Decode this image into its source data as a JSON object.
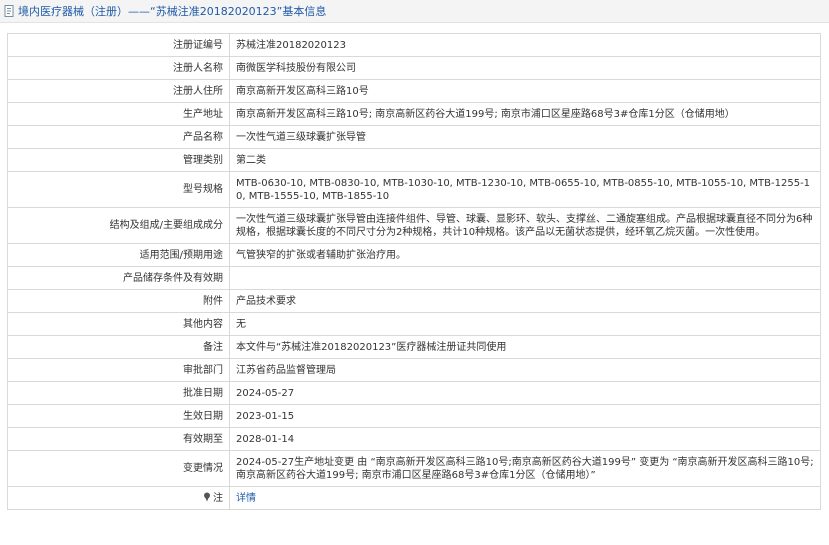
{
  "header": {
    "title": "境内医疗器械（注册）——“苏械注准20182020123”基本信息"
  },
  "rows": [
    {
      "label": "注册证编号",
      "value": "苏械注准20182020123"
    },
    {
      "label": "注册人名称",
      "value": "南微医学科技股份有限公司"
    },
    {
      "label": "注册人住所",
      "value": "南京高新开发区高科三路10号"
    },
    {
      "label": "生产地址",
      "value": "南京高新开发区高科三路10号; 南京高新区药谷大道199号; 南京市浦口区星座路68号3#仓库1分区（仓储用地）"
    },
    {
      "label": "产品名称",
      "value": "一次性气道三级球囊扩张导管"
    },
    {
      "label": "管理类别",
      "value": "第二类"
    },
    {
      "label": "型号规格",
      "value": "MTB-0630-10, MTB-0830-10, MTB-1030-10, MTB-1230-10, MTB-0655-10, MTB-0855-10, MTB-1055-10, MTB-1255-10, MTB-1555-10, MTB-1855-10"
    },
    {
      "label": "结构及组成/主要组成成分",
      "value": "一次性气道三级球囊扩张导管由连接件组件、导管、球囊、显影环、软头、支撑丝、二通旋塞组成。产品根据球囊直径不同分为6种规格，根据球囊长度的不同尺寸分为2种规格，共计10种规格。该产品以无菌状态提供，经环氧乙烷灭菌。一次性使用。"
    },
    {
      "label": "适用范围/预期用途",
      "value": "气管狭窄的扩张或者辅助扩张治疗用。"
    },
    {
      "label": "产品储存条件及有效期",
      "value": ""
    },
    {
      "label": "附件",
      "value": "产品技术要求"
    },
    {
      "label": "其他内容",
      "value": "无"
    },
    {
      "label": "备注",
      "value": "本文件与“苏械注准20182020123”医疗器械注册证共同使用"
    },
    {
      "label": "审批部门",
      "value": "江苏省药品监督管理局"
    },
    {
      "label": "批准日期",
      "value": "2024-05-27"
    },
    {
      "label": "生效日期",
      "value": "2023-01-15"
    },
    {
      "label": "有效期至",
      "value": "2028-01-14"
    },
    {
      "label": "变更情况",
      "value": "2024-05-27生产地址变更 由 “南京高新开发区高科三路10号;南京高新区药谷大道199号” 变更为 “南京高新开发区高科三路10号; 南京高新区药谷大道199号; 南京市浦口区星座路68号3#仓库1分区（仓储用地）”"
    }
  ],
  "footer": {
    "label": "注",
    "link": "详情"
  },
  "colors": {
    "link": "#1f5aa8",
    "border": "#d9d9d9",
    "header_bg": "#f4f4f4"
  }
}
